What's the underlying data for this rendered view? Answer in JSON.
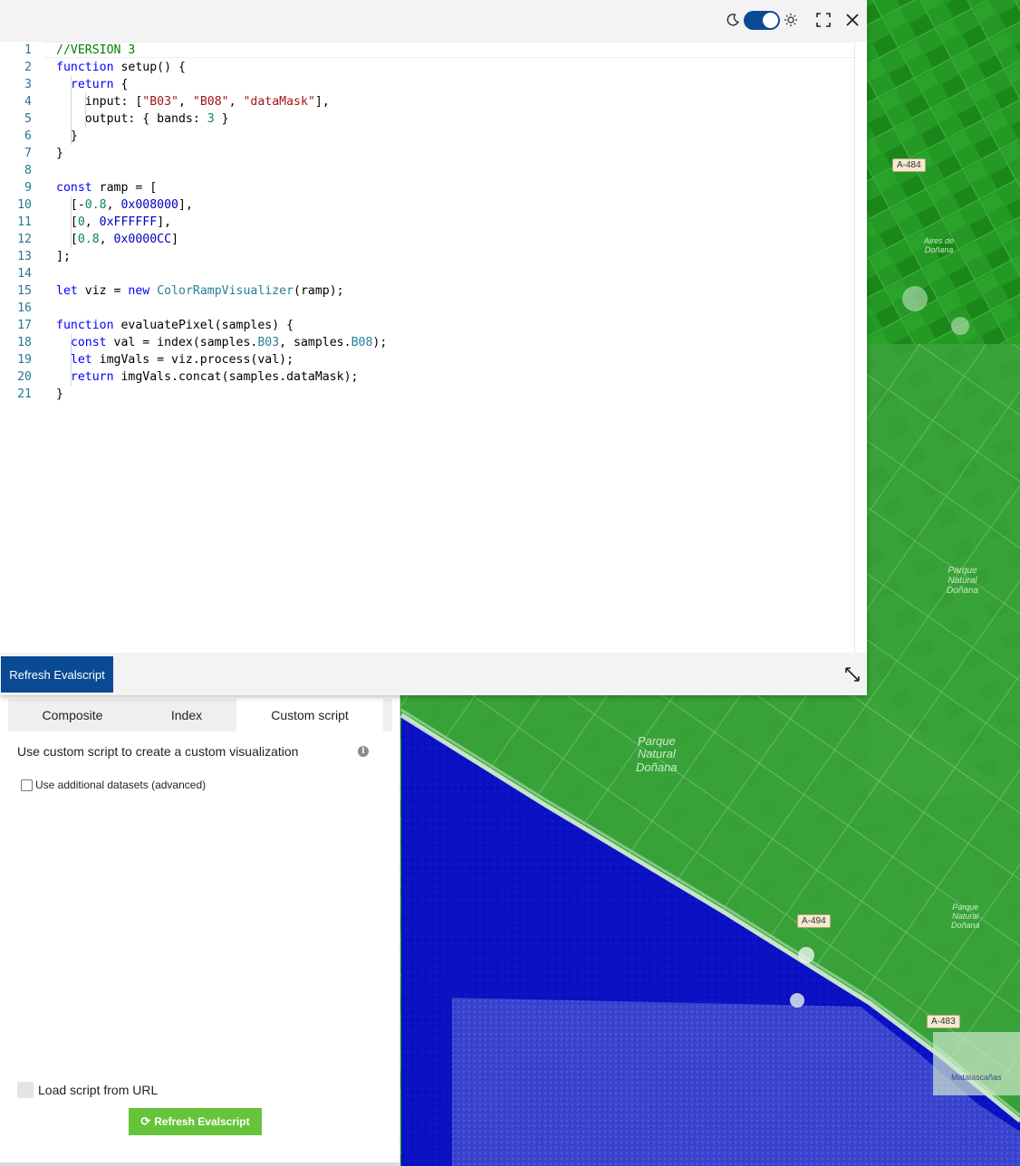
{
  "map": {
    "labels": {
      "parque_left": "Parque\nNatural\nDoñana",
      "parque_right_top": "Parque\nNatural\nDoñana",
      "parque_right_bottom": "Parque\nNatural\nDoñana",
      "aires": "Aires de\nDoñana",
      "matalascanas": "Matalascañas"
    },
    "roads": {
      "a484": "A-484",
      "a494": "A-494",
      "a483": "A-483"
    },
    "colors": {
      "land": "#1f8f1f",
      "water": "#0008b8",
      "light": "#cfe8cf"
    }
  },
  "editor": {
    "toolbar": {
      "moon_icon": "moon-icon",
      "toggle_state": "on",
      "sun_icon": "sun-icon",
      "fullscreen_icon": "fullscreen-icon",
      "close_icon": "close-icon"
    },
    "lines": [
      {
        "n": "1"
      },
      {
        "n": "2"
      },
      {
        "n": "3"
      },
      {
        "n": "4"
      },
      {
        "n": "5"
      },
      {
        "n": "6"
      },
      {
        "n": "7"
      },
      {
        "n": "8"
      },
      {
        "n": "9"
      },
      {
        "n": "10"
      },
      {
        "n": "11"
      },
      {
        "n": "12"
      },
      {
        "n": "13"
      },
      {
        "n": "14"
      },
      {
        "n": "15"
      },
      {
        "n": "16"
      },
      {
        "n": "17"
      },
      {
        "n": "18"
      },
      {
        "n": "19"
      },
      {
        "n": "20"
      },
      {
        "n": "21"
      }
    ],
    "code": [
      [
        {
          "t": "//VERSION 3",
          "c": "cm"
        }
      ],
      [
        {
          "t": "function",
          "c": "kw"
        },
        {
          "t": " setup() {",
          "c": ""
        }
      ],
      [
        {
          "t": "  ",
          "c": ""
        },
        {
          "t": "return",
          "c": "kw"
        },
        {
          "t": " {",
          "c": ""
        }
      ],
      [
        {
          "t": "    input: [",
          "c": ""
        },
        {
          "t": "\"B03\"",
          "c": "str"
        },
        {
          "t": ", ",
          "c": ""
        },
        {
          "t": "\"B08\"",
          "c": "str"
        },
        {
          "t": ", ",
          "c": ""
        },
        {
          "t": "\"dataMask\"",
          "c": "str"
        },
        {
          "t": "],",
          "c": ""
        }
      ],
      [
        {
          "t": "    output: { bands: ",
          "c": ""
        },
        {
          "t": "3",
          "c": "num"
        },
        {
          "t": " }",
          "c": ""
        }
      ],
      [
        {
          "t": "  }",
          "c": ""
        }
      ],
      [
        {
          "t": "}",
          "c": ""
        }
      ],
      [],
      [
        {
          "t": "const",
          "c": "kw"
        },
        {
          "t": " ramp = [",
          "c": ""
        }
      ],
      [
        {
          "t": "  [-",
          "c": ""
        },
        {
          "t": "0.8",
          "c": "num"
        },
        {
          "t": ", ",
          "c": ""
        },
        {
          "t": "0x008000",
          "c": "hex"
        },
        {
          "t": "],",
          "c": ""
        }
      ],
      [
        {
          "t": "  [",
          "c": ""
        },
        {
          "t": "0",
          "c": "num"
        },
        {
          "t": ", ",
          "c": ""
        },
        {
          "t": "0xFFFFFF",
          "c": "hex"
        },
        {
          "t": "],",
          "c": ""
        }
      ],
      [
        {
          "t": "  [",
          "c": ""
        },
        {
          "t": "0.8",
          "c": "num"
        },
        {
          "t": ", ",
          "c": ""
        },
        {
          "t": "0x0000CC",
          "c": "hex"
        },
        {
          "t": "]",
          "c": ""
        }
      ],
      [
        {
          "t": "];",
          "c": ""
        }
      ],
      [],
      [
        {
          "t": "let",
          "c": "kw"
        },
        {
          "t": " viz = ",
          "c": ""
        },
        {
          "t": "new",
          "c": "kw"
        },
        {
          "t": " ",
          "c": ""
        },
        {
          "t": "ColorRampVisualizer",
          "c": "typ"
        },
        {
          "t": "(ramp);",
          "c": ""
        }
      ],
      [],
      [
        {
          "t": "function",
          "c": "kw"
        },
        {
          "t": " evaluatePixel(samples) {",
          "c": ""
        }
      ],
      [
        {
          "t": "  ",
          "c": ""
        },
        {
          "t": "const",
          "c": "kw"
        },
        {
          "t": " val = index(samples.",
          "c": ""
        },
        {
          "t": "B03",
          "c": "prop"
        },
        {
          "t": ", samples.",
          "c": ""
        },
        {
          "t": "B08",
          "c": "prop"
        },
        {
          "t": ");",
          "c": ""
        }
      ],
      [
        {
          "t": "  ",
          "c": ""
        },
        {
          "t": "let",
          "c": "kw"
        },
        {
          "t": " imgVals = viz.process(val);",
          "c": ""
        }
      ],
      [
        {
          "t": "  ",
          "c": ""
        },
        {
          "t": "return",
          "c": "kw"
        },
        {
          "t": " imgVals.concat(samples.dataMask);",
          "c": ""
        }
      ],
      [
        {
          "t": "}",
          "c": ""
        }
      ]
    ],
    "footer": {
      "refresh_label": "Refresh Evalscript",
      "expand_icon": "expand-icon"
    }
  },
  "panel": {
    "tabs": [
      {
        "label": "Composite",
        "active": false
      },
      {
        "label": "Index",
        "active": false
      },
      {
        "label": "Custom script",
        "active": true
      }
    ],
    "description": "Use custom script to create a custom visualization",
    "info_icon": "info-icon",
    "info_glyph": "i",
    "additional_datasets_label": "Use additional datasets (advanced)",
    "load_url_label": "Load script from URL",
    "refresh_icon_glyph": "⟳",
    "refresh_label": "Refresh Evalscript",
    "accent_green": "#65c43a",
    "accent_blue": "#0a4a94"
  }
}
